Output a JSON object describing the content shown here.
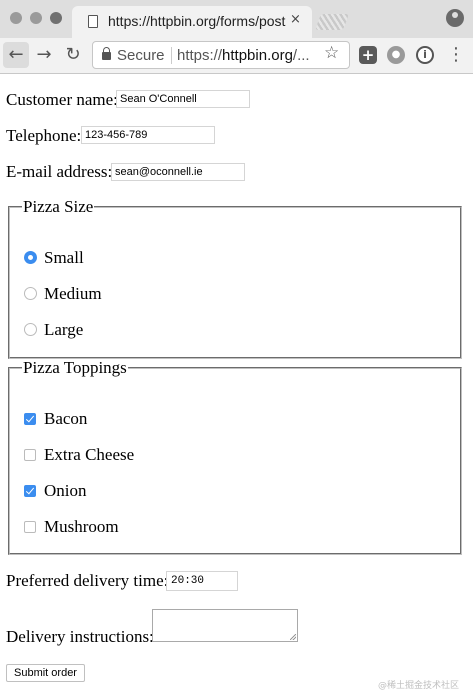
{
  "browser": {
    "tab_title": "https://httpbin.org/forms/post",
    "secure_label": "Secure",
    "url_prefix": "https://",
    "url_host": "httpbin.org",
    "url_suffix": "/...",
    "close_glyph": "×",
    "back_glyph": "←",
    "forward_glyph": "→",
    "reload_glyph": "↻",
    "star_glyph": "☆",
    "menu_glyph": "⋮"
  },
  "form": {
    "customer_name": {
      "label": "Customer name:",
      "value": "Sean O'Connell"
    },
    "telephone": {
      "label": "Telephone:",
      "value": "123-456-789"
    },
    "email": {
      "label": "E-mail address:",
      "value": "sean@oconnell.ie"
    },
    "pizza_size": {
      "legend": "Pizza Size",
      "options": [
        {
          "label": "Small",
          "selected": true
        },
        {
          "label": "Medium",
          "selected": false
        },
        {
          "label": "Large",
          "selected": false
        }
      ]
    },
    "pizza_toppings": {
      "legend": "Pizza Toppings",
      "options": [
        {
          "label": "Bacon",
          "checked": true
        },
        {
          "label": "Extra Cheese",
          "checked": false
        },
        {
          "label": "Onion",
          "checked": true
        },
        {
          "label": "Mushroom",
          "checked": false
        }
      ]
    },
    "delivery_time": {
      "label": "Preferred delivery time:",
      "value": "20:30"
    },
    "delivery_instructions": {
      "label": "Delivery instructions:",
      "value": ""
    },
    "submit_label": "Submit order"
  },
  "watermark": "@稀土掘金技术社区",
  "colors": {
    "accent": "#3b8def",
    "chrome_bg": "#f2f2f2",
    "tabbar_bg": "#dedede"
  }
}
